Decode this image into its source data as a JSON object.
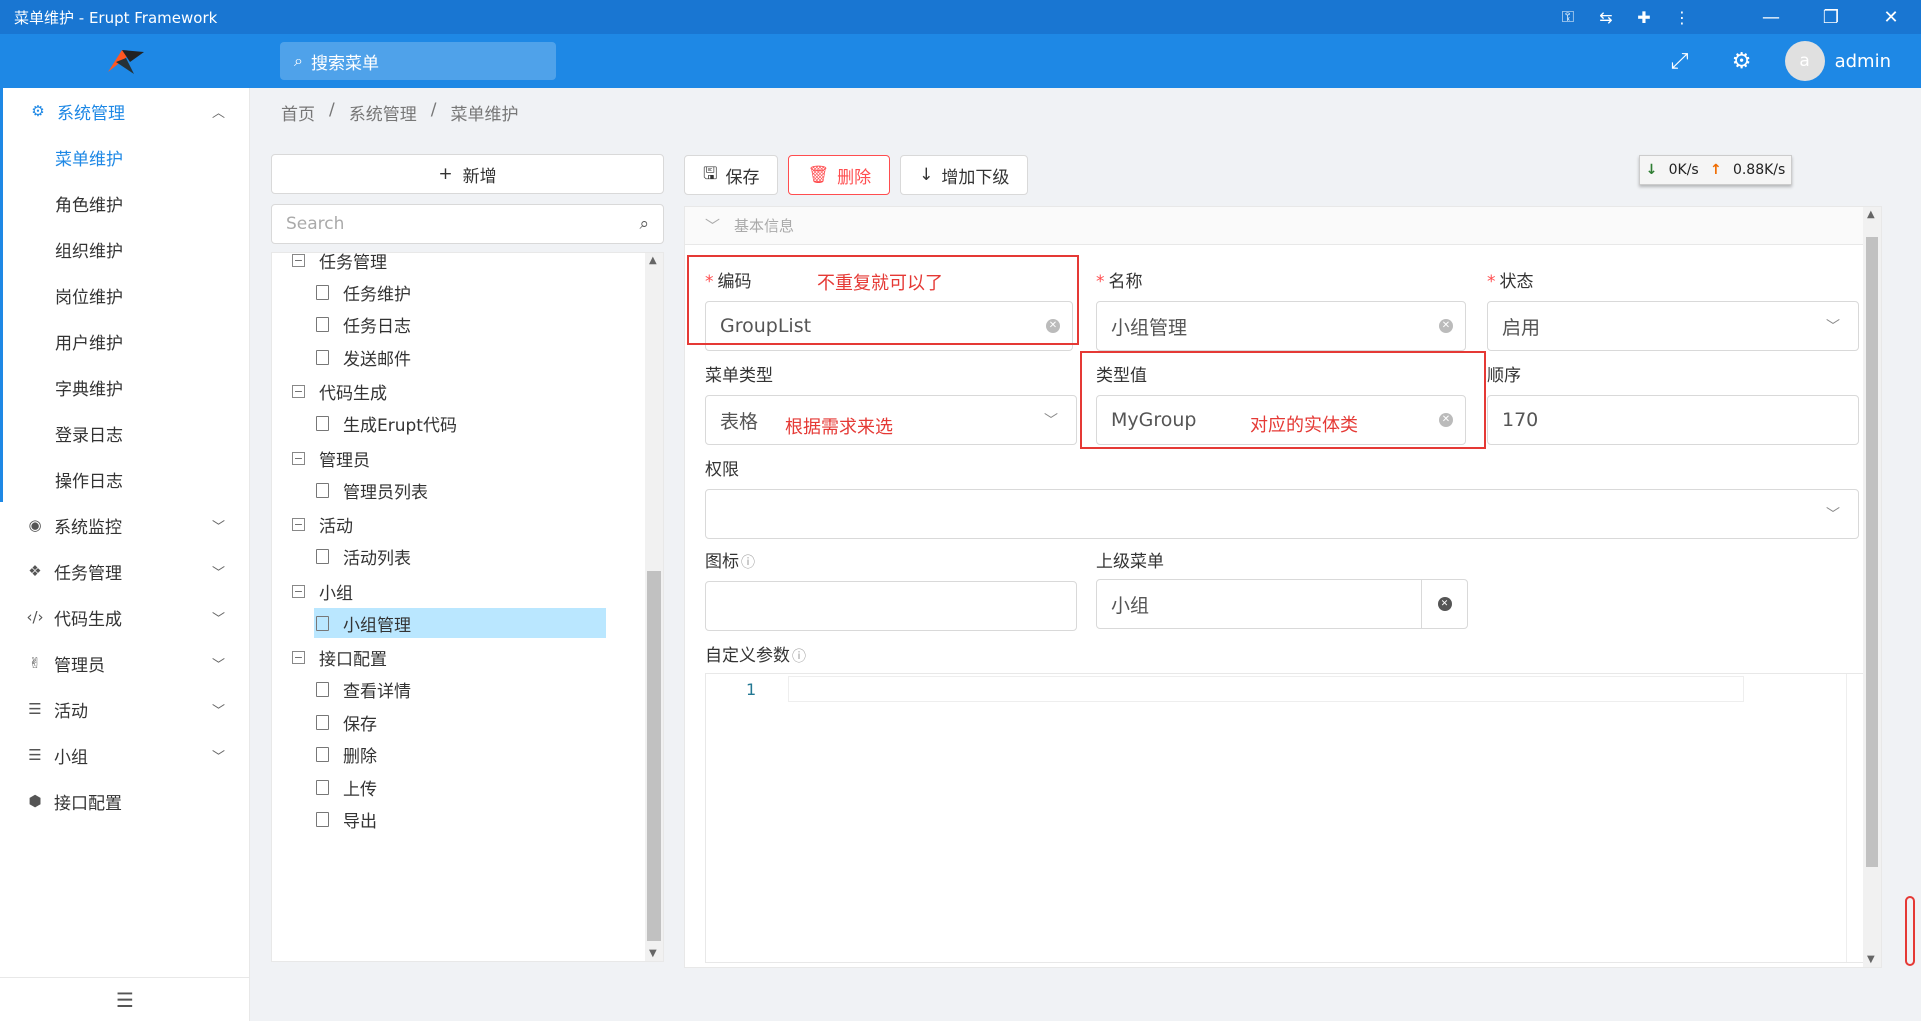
{
  "window": {
    "title": "菜单维护 - Erupt Framework"
  },
  "header": {
    "search_placeholder": "搜索菜单",
    "username": "admin",
    "avatar_letter": "a"
  },
  "sidebar": {
    "groups": [
      {
        "label": "系统管理",
        "icon": "gears-icon",
        "expanded": true,
        "children": [
          "菜单维护",
          "角色维护",
          "组织维护",
          "岗位维护",
          "用户维护",
          "字典维护",
          "登录日志",
          "操作日志"
        ]
      },
      {
        "label": "系统监控",
        "icon": "monitor-icon"
      },
      {
        "label": "任务管理",
        "icon": "cubes-icon"
      },
      {
        "label": "代码生成",
        "icon": "code-icon"
      },
      {
        "label": "管理员",
        "icon": "medal-icon"
      },
      {
        "label": "活动",
        "icon": "list-icon"
      },
      {
        "label": "小组",
        "icon": "list-icon"
      },
      {
        "label": "接口配置",
        "icon": "cube-icon"
      }
    ]
  },
  "breadcrumb": [
    "首页",
    "/",
    "系统管理",
    "/",
    "菜单维护"
  ],
  "left_panel": {
    "add_label": "新增",
    "search_placeholder": "Search",
    "tree": [
      {
        "type": "node",
        "label": "任务管理"
      },
      {
        "type": "leaf",
        "label": "任务维护"
      },
      {
        "type": "leaf",
        "label": "任务日志"
      },
      {
        "type": "leaf",
        "label": "发送邮件"
      },
      {
        "type": "node",
        "label": "代码生成"
      },
      {
        "type": "leaf",
        "label": "生成Erupt代码"
      },
      {
        "type": "node",
        "label": "管理员"
      },
      {
        "type": "leaf",
        "label": "管理员列表"
      },
      {
        "type": "node",
        "label": "活动"
      },
      {
        "type": "leaf",
        "label": "活动列表"
      },
      {
        "type": "node",
        "label": "小组"
      },
      {
        "type": "leaf",
        "label": "小组管理",
        "selected": true
      },
      {
        "type": "node",
        "label": "接口配置"
      },
      {
        "type": "leaf",
        "label": "查看详情"
      },
      {
        "type": "leaf",
        "label": "保存"
      },
      {
        "type": "leaf",
        "label": "删除"
      },
      {
        "type": "leaf",
        "label": "上传"
      },
      {
        "type": "leaf",
        "label": "导出"
      }
    ]
  },
  "toolbar": {
    "save_label": "保存",
    "delete_label": "删除",
    "add_child_label": "增加下级"
  },
  "netspeed": {
    "down": "0K/s",
    "up": "0.88K/s"
  },
  "form": {
    "section_title": "基本信息",
    "code": {
      "label": "编码",
      "value": "GroupList"
    },
    "name": {
      "label": "名称",
      "value": "小组管理"
    },
    "status": {
      "label": "状态",
      "value": "启用"
    },
    "menu_type": {
      "label": "菜单类型",
      "value": "表格"
    },
    "type_value": {
      "label": "类型值",
      "value": "MyGroup"
    },
    "order": {
      "label": "顺序",
      "value": "170"
    },
    "permission": {
      "label": "权限",
      "value": ""
    },
    "icon": {
      "label": "图标",
      "value": ""
    },
    "parent_menu": {
      "label": "上级菜单",
      "value": "小组"
    },
    "custom_params": {
      "label": "自定义参数",
      "line_number": "1"
    }
  },
  "annotations": {
    "code_note": "不重复就可以了",
    "menu_type_note": "根据需求来选",
    "type_value_note": "对应的实体类"
  }
}
